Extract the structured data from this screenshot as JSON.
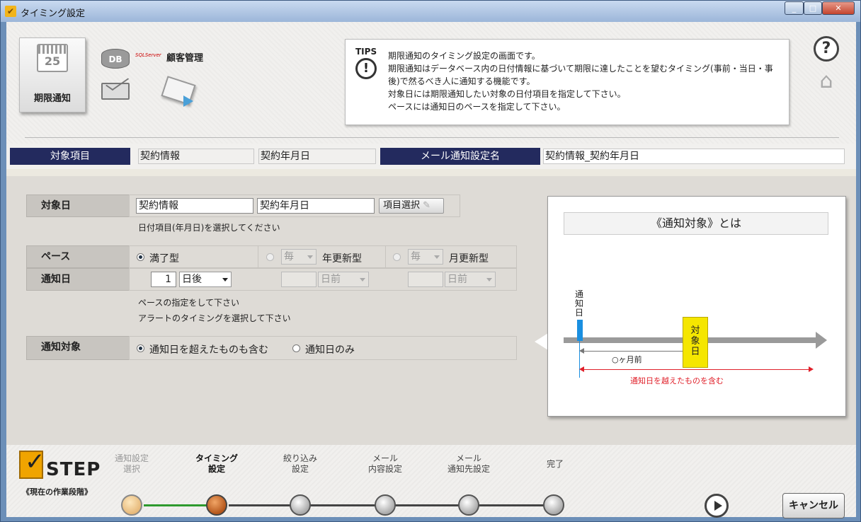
{
  "window": {
    "title": "タイミング設定",
    "controls": {
      "minimize": "_",
      "maximize": "□",
      "close": "✕"
    }
  },
  "top": {
    "tile_label": "期限通知",
    "calendar_day": "25",
    "db_label": "DB",
    "db_logo": "SQLServer",
    "kokyaku_label": "顧客管理",
    "help_icon": "?",
    "tips": {
      "label": "TIPS",
      "lines": [
        "期限通知のタイミング設定の画面です。",
        "期限通知はデータベース内の日付情報に基づいて期限に達したことを望むタイミング(事前・当日・事",
        "後)で然るべき人に通知する機能です。",
        "対象日には期限通知したい対象の日付項目を指定して下さい。",
        "ペースには通知日のペースを指定して下さい。"
      ]
    }
  },
  "header": {
    "target_label": "対象項目",
    "target_value1": "契約情報",
    "target_value2": "契約年月日",
    "mail_label": "メール通知設定名",
    "mail_value": "契約情報_契約年月日"
  },
  "form": {
    "target_date": {
      "label": "対象日",
      "value1": "契約情報",
      "value2": "契約年月日",
      "select_button": "項目選択",
      "hint": "日付項目(年月日)を選択してください"
    },
    "pace": {
      "label": "ペース",
      "option1": "満了型",
      "option2": "年更新型",
      "option2_sel": "毎",
      "option3": "月更新型",
      "option3_sel": "毎"
    },
    "notify_day": {
      "label": "通知日",
      "value": "1",
      "select1": "日後",
      "select2": "日前",
      "select3": "日前"
    },
    "hints": [
      "ペースの指定をして下さい",
      "アラートのタイミングを選択して下さい"
    ],
    "notify_target": {
      "label": "通知対象",
      "option1": "通知日を超えたものも含む",
      "option2": "通知日のみ"
    }
  },
  "diagram": {
    "title": "《通知対象》とは",
    "notify_day_label": "通知日",
    "target_day_label": "対象日",
    "months_label": "○ヶ月前",
    "range_label": "通知日を越えたものを含む"
  },
  "steps": {
    "logo_text": "STEP",
    "subtitle": "《現在の作業段階》",
    "items": [
      {
        "label_l1": "通知設定",
        "label_l2": "選択"
      },
      {
        "label_l1": "タイミング",
        "label_l2": "設定"
      },
      {
        "label_l1": "絞り込み",
        "label_l2": "設定"
      },
      {
        "label_l1": "メール",
        "label_l2": "内容設定"
      },
      {
        "label_l1": "メール",
        "label_l2": "通知先設定"
      },
      {
        "label_l1": "完了",
        "label_l2": ""
      }
    ],
    "cancel": "キャンセル"
  },
  "colors": {
    "navy": "#232a5e",
    "accent_blue": "#1a8fe0",
    "range_red": "#e0202a",
    "yellow": "#f5e600"
  }
}
